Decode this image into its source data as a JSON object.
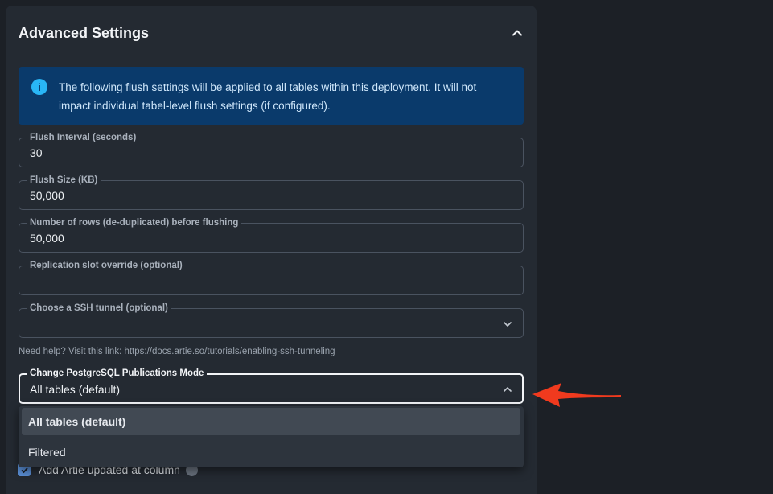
{
  "panel": {
    "title": "Advanced Settings"
  },
  "info": {
    "text": "The following flush settings will be applied to all tables within this deployment. It will not impact individual tabel-level flush settings (if configured)."
  },
  "fields": {
    "flush_interval": {
      "label": "Flush Interval (seconds)",
      "value": "30"
    },
    "flush_size": {
      "label": "Flush Size (KB)",
      "value": "50,000"
    },
    "rows_before_flush": {
      "label": "Number of rows (de-duplicated) before flushing",
      "value": "50,000"
    },
    "replication_slot": {
      "label": "Replication slot override (optional)",
      "value": ""
    },
    "ssh_tunnel": {
      "label": "Choose a SSH tunnel (optional)",
      "value": ""
    },
    "publications_mode": {
      "label": "Change PostgreSQL Publications Mode",
      "value": "All tables (default)"
    }
  },
  "help": {
    "text": "Need help? Visit this link: https://docs.artie.so/tutorials/enabling-ssh-tunneling"
  },
  "dropdown": {
    "options": [
      "All tables (default)",
      "Filtered"
    ],
    "selected": "All tables (default)"
  },
  "checkboxes": {
    "updated_at": "Add Artie updated at column"
  },
  "colors": {
    "background": "#1c2026",
    "panel": "#242a32",
    "info_bg": "#0a3a6b",
    "info_icon": "#29b6f6",
    "arrow": "#f03a1e",
    "checkbox": "#5a8fd6"
  }
}
